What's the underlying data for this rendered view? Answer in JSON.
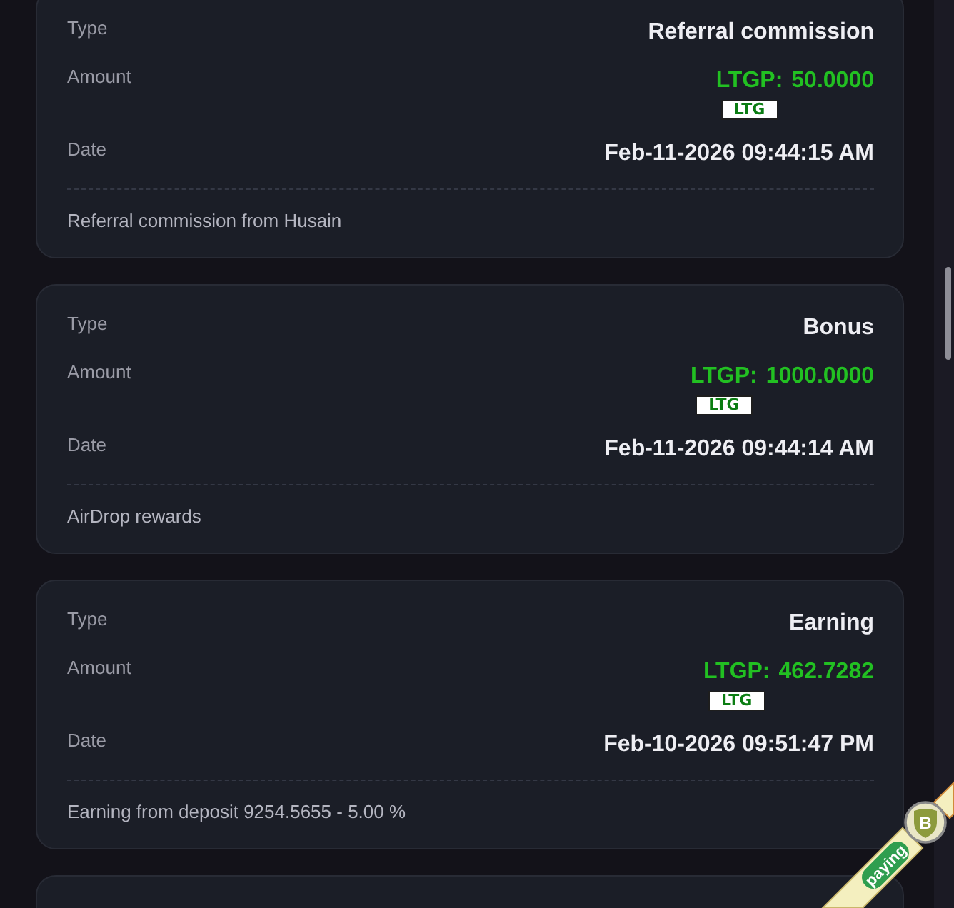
{
  "transactions": [
    {
      "type_label": "Type",
      "type": "Referral commission",
      "amount_label": "Amount",
      "currency": "LTGP:",
      "amount": "50.0000",
      "token_badge": "LTG",
      "date_label": "Date",
      "date": "Feb-11-2026 09:44:15 AM",
      "note": "Referral commission from Husain"
    },
    {
      "type_label": "Type",
      "type": "Bonus",
      "amount_label": "Amount",
      "currency": "LTGP:",
      "amount": "1000.0000",
      "token_badge": "LTG",
      "date_label": "Date",
      "date": "Feb-11-2026 09:44:14 AM",
      "note": "AirDrop rewards"
    },
    {
      "type_label": "Type",
      "type": "Earning",
      "amount_label": "Amount",
      "currency": "LTGP:",
      "amount": "462.7282",
      "token_badge": "LTG",
      "date_label": "Date",
      "date": "Feb-10-2026 09:51:47 PM",
      "note": "Earning from deposit 9254.5655 - 5.00 %"
    }
  ],
  "more_below": true,
  "ribbon": {
    "status": "paying",
    "badge_letter": "B"
  }
}
